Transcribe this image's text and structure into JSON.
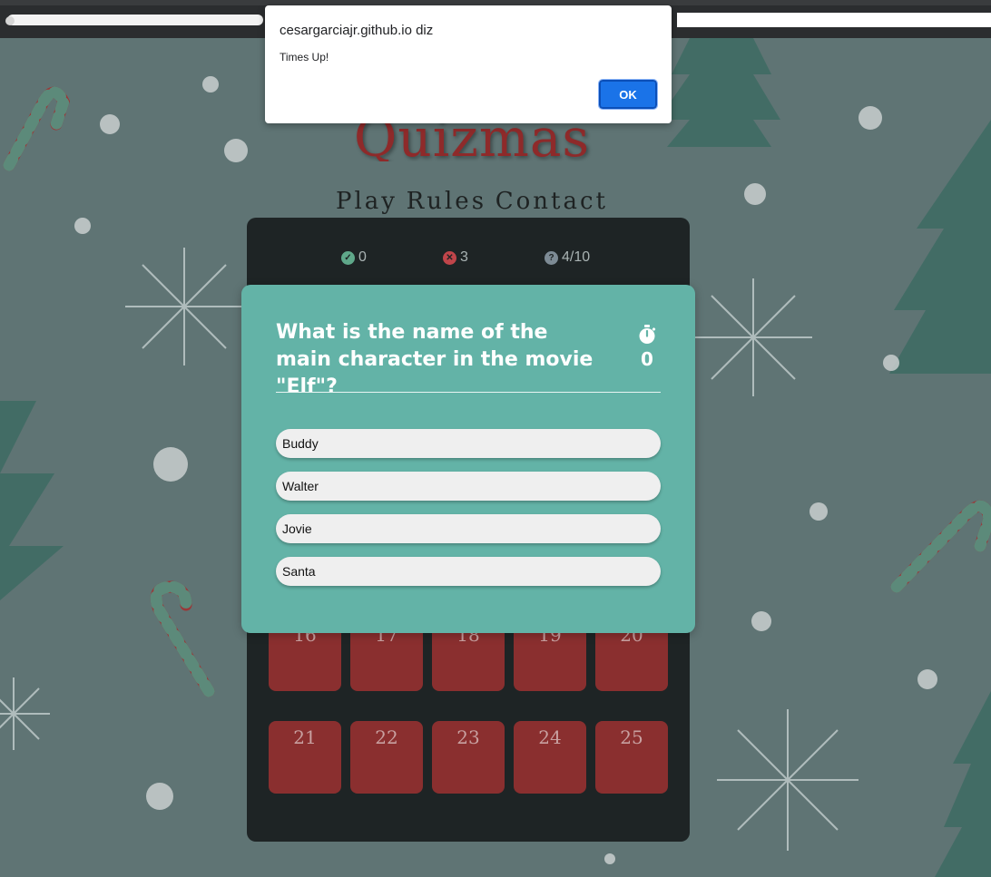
{
  "alert": {
    "title": "cesargarciajr.github.io diz",
    "message": "Times Up!",
    "ok_label": "OK"
  },
  "header": {
    "logo_text": "Quizmas",
    "nav": [
      "Play",
      "Rules",
      "Contact"
    ]
  },
  "stats": {
    "correct": "0",
    "wrong": "3",
    "progress": "4/10"
  },
  "modal": {
    "question": "What is the name of the main character in the movie \"Elf\"?",
    "timer_icon": "stopwatch-icon",
    "timer_value": "0",
    "answers": [
      "Buddy",
      "Walter",
      "Jovie",
      "Santa"
    ]
  },
  "tiles": [
    "16",
    "17",
    "18",
    "19",
    "20",
    "21",
    "22",
    "23",
    "24",
    "25"
  ],
  "colors": {
    "background": "#5f7474",
    "board": "#1e2425",
    "tile": "#8a2f2f",
    "modal": "#63b3a7",
    "alert_button": "#1a73e8"
  }
}
